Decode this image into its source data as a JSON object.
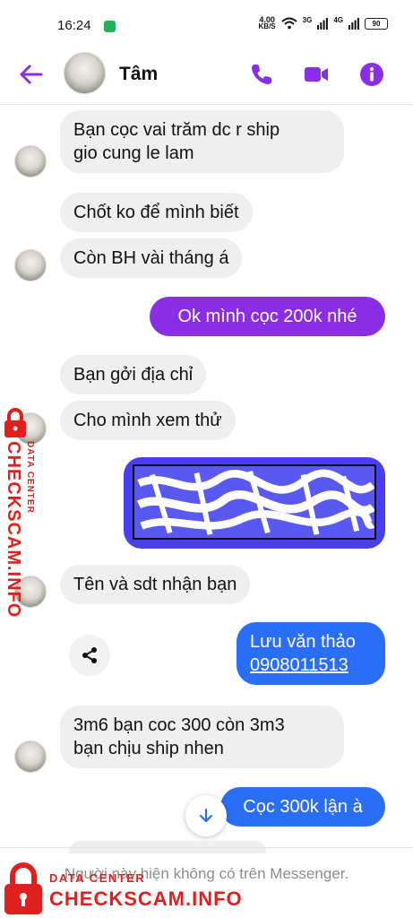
{
  "status_bar": {
    "time": "16:24",
    "net_speed_value": "4.00",
    "net_speed_unit": "KB/S",
    "network_1": "3G",
    "network_2": "4G",
    "battery": "90"
  },
  "header": {
    "contact_name": "Tâm",
    "accent_color": "#8a2ee6"
  },
  "messages": [
    {
      "from": "them",
      "text_lines": [
        "Bạn cọc vai trăm dc r ship",
        "gio cung le lam"
      ]
    },
    {
      "from": "them",
      "text": "Chốt ko để mình biết"
    },
    {
      "from": "them",
      "text": "Còn BH vài tháng á"
    },
    {
      "from": "me",
      "text": "Ok mình cọc 200k nhé"
    },
    {
      "from": "them",
      "text": "Bạn gởi địa chỉ"
    },
    {
      "from": "them",
      "text": "Cho mình xem thử"
    },
    {
      "from": "me",
      "type": "image"
    },
    {
      "from": "them",
      "text": "Tên và sdt nhận bạn"
    },
    {
      "from": "me",
      "text": "Lưu văn thảo",
      "phone": "0908011513"
    },
    {
      "from": "them",
      "text_lines": [
        "3m6 bạn coc 300 còn 3m3",
        "bạn chịu ship nhen"
      ]
    },
    {
      "from": "me",
      "text": "Cọc 300k lận à"
    }
  ],
  "footer": {
    "notice": "Người này hiện không có trên Messenger."
  },
  "watermark": {
    "line1": "DATA CENTER",
    "line2": "CHECKSCAM.INFO",
    "color": "#e0201e"
  }
}
